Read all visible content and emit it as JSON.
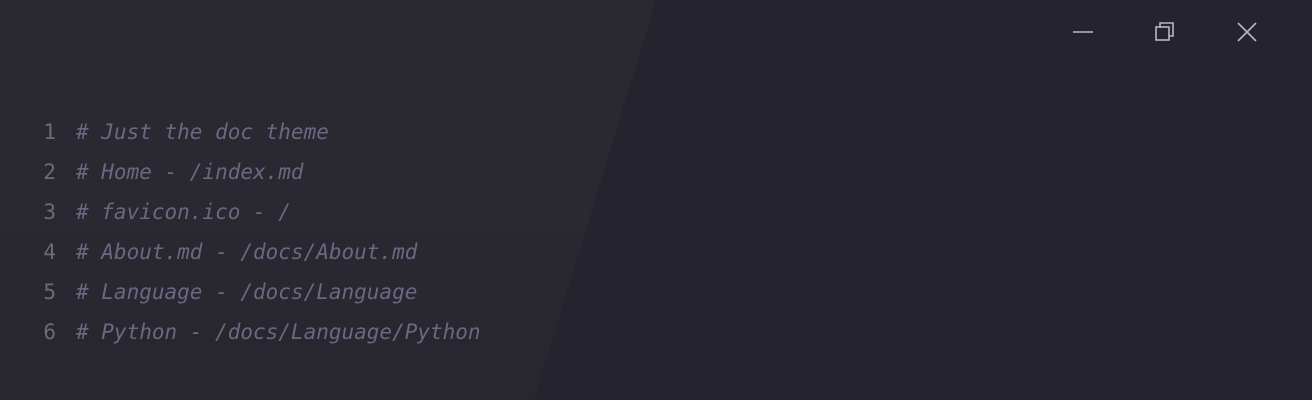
{
  "window_controls": {
    "minimize_icon": "minimize-icon",
    "restore_icon": "restore-icon",
    "close_icon": "close-icon"
  },
  "editor": {
    "lines": [
      {
        "number": "1",
        "text": "# Just the doc theme"
      },
      {
        "number": "2",
        "text": "# Home - /index.md"
      },
      {
        "number": "3",
        "text": "# favicon.ico - /"
      },
      {
        "number": "4",
        "text": "# About.md - /docs/About.md"
      },
      {
        "number": "5",
        "text": "# Language - /docs/Language"
      },
      {
        "number": "6",
        "text": "# Python - /docs/Language/Python"
      }
    ]
  },
  "colors": {
    "background": "#25232d",
    "comment": "#6a6882",
    "line_number": "#6d6b74",
    "icon": "#b9b7c0"
  }
}
